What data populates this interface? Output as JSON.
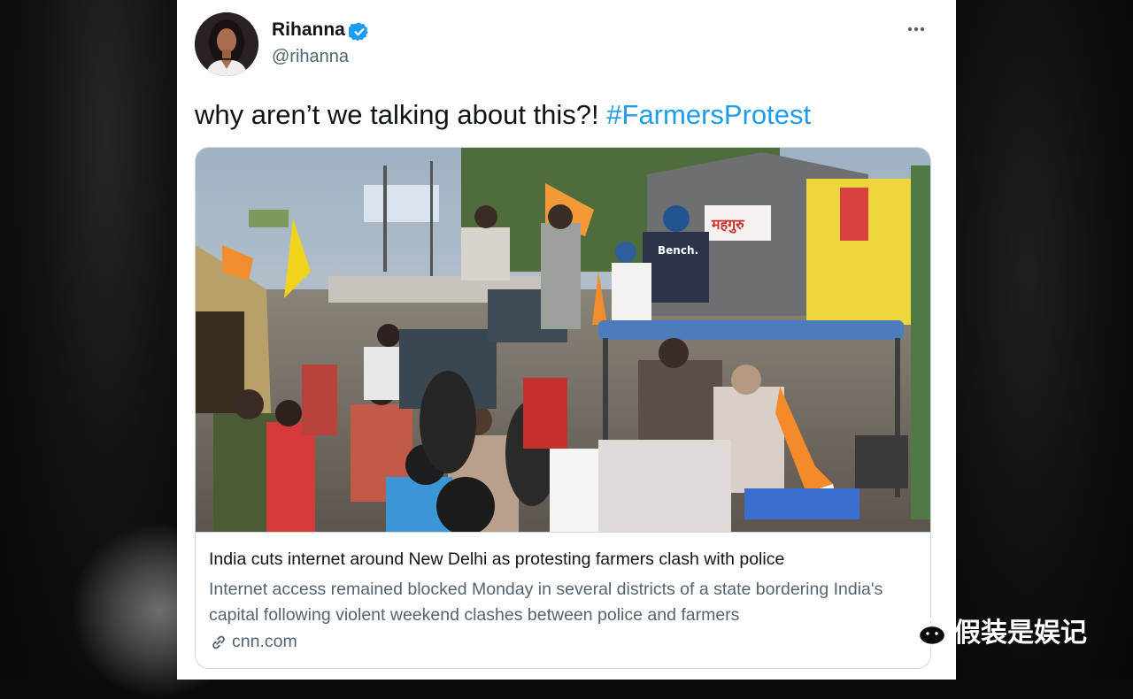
{
  "tweet": {
    "author_name": "Rihanna",
    "author_handle": "@rihanna",
    "verified": true,
    "text_plain": "why aren’t we talking about this?! ",
    "hashtag": "#FarmersProtest",
    "accent_color": "#1d9bf0"
  },
  "card": {
    "headline": "India cuts internet around New Delhi as protesting farmers clash with police",
    "description": "Internet access remained blocked Monday in several districts of a state bordering India's capital following violent weekend clashes between police and farmers",
    "domain": "cnn.com",
    "image_signs": {
      "bench_shirt": "Bench.",
      "shop_sign": "महगुरु"
    }
  },
  "watermark": {
    "text": "假装是娱记",
    "icon": "wechat-icon"
  },
  "icons": {
    "verified": "verified-badge-icon",
    "more": "more-icon",
    "link": "link-icon"
  }
}
